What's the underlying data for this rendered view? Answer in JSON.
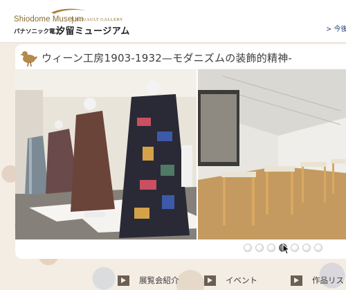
{
  "header": {
    "logo_museum": "Shiodome Museum",
    "logo_gallery": "ROUAULT GALLERY",
    "logo_company": "パナソニック電工",
    "logo_name": "汐留ミュージアム",
    "top_link": "> 今後"
  },
  "exhibition": {
    "title": "ウィーン工房1903-1932—モダニズムの装飾的精神-"
  },
  "slider": {
    "dot_count": 7,
    "active_index": 3
  },
  "nav": {
    "items": [
      {
        "label": "展覧会紹介"
      },
      {
        "label": "イベント"
      },
      {
        "label": "作品リス"
      }
    ]
  },
  "colors": {
    "accent_gold": "#8a6a2e",
    "link_blue": "#2a3f7a",
    "nav_arrow": "#6b5e53"
  }
}
